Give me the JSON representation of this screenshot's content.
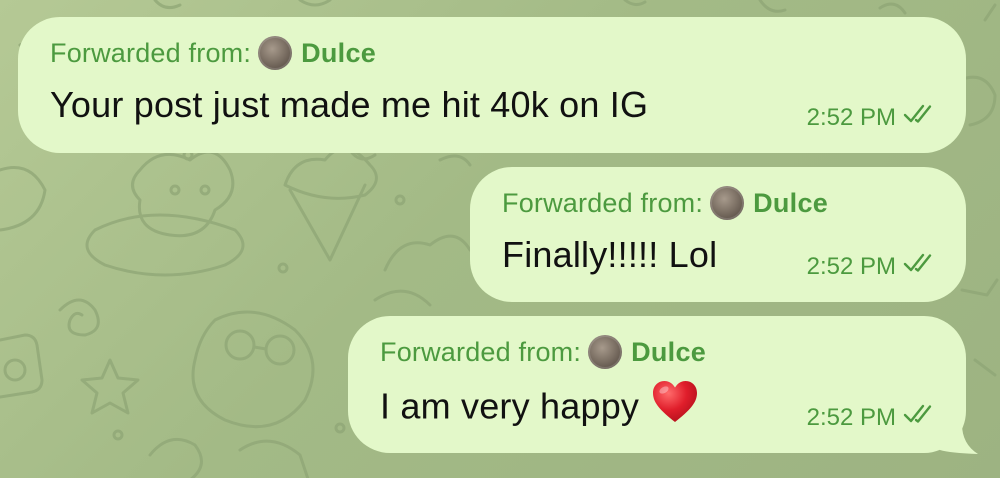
{
  "chat": {
    "messages": [
      {
        "forwarded_label": "Forwarded from:",
        "forwarded_name": "Dulce",
        "text": "Your post just made me hit 40k on IG",
        "time": "2:52 PM",
        "status_icon": "double-check-icon",
        "emoji": ""
      },
      {
        "forwarded_label": "Forwarded from:",
        "forwarded_name": "Dulce",
        "text": "Finally!!!!! Lol",
        "time": "2:52 PM",
        "status_icon": "double-check-icon",
        "emoji": ""
      },
      {
        "forwarded_label": "Forwarded from:",
        "forwarded_name": "Dulce",
        "text": "I am very happy",
        "time": "2:52 PM",
        "status_icon": "double-check-icon",
        "emoji": "heart-emoji"
      }
    ]
  },
  "colors": {
    "bubble_bg": "#e3f8c9",
    "accent_green": "#4c9a3f",
    "text": "#111111",
    "wallpaper": "#a7bd8a"
  }
}
